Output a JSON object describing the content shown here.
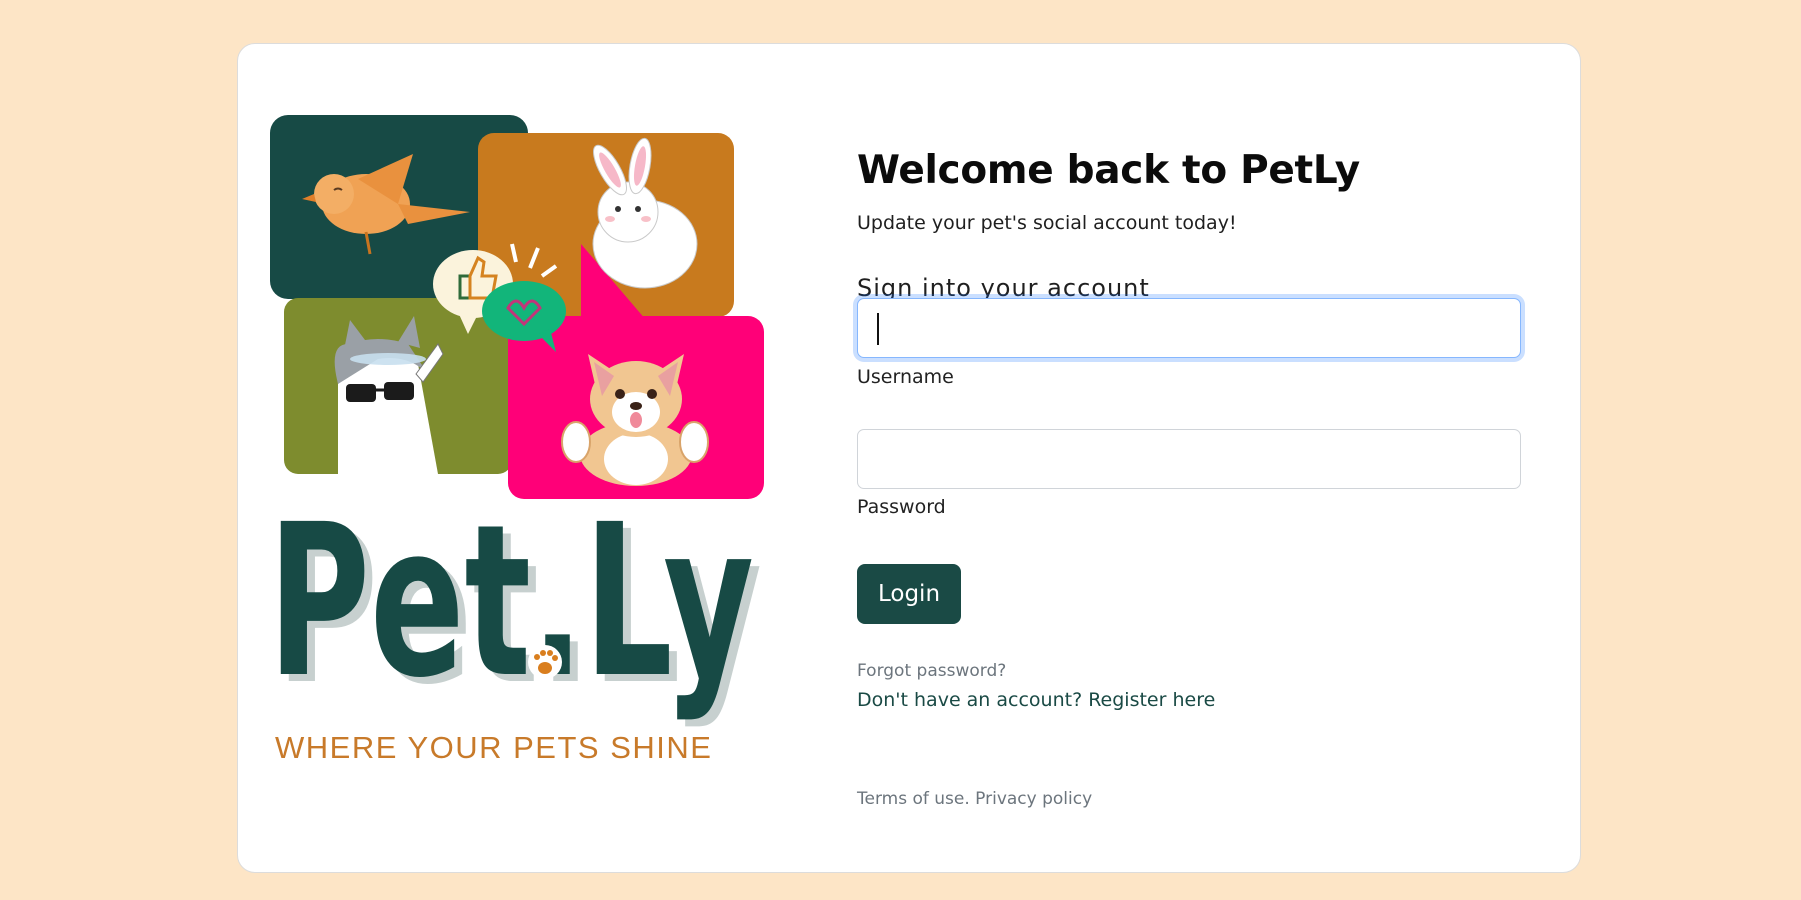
{
  "colors": {
    "page_background": "#fde5c6",
    "brand_dark_green": "#1a4a45",
    "bubble_orange": "#c87a1e",
    "bubble_olive": "#7e8c2e",
    "bubble_pink": "#ff0078",
    "tagline_orange": "#c87a2a",
    "focus_ring": "#86b7fe"
  },
  "logo": {
    "wordmark": "Pet.Ly",
    "tagline": "WHERE YOUR PETS SHINE",
    "illustrations": [
      "bird-icon",
      "rabbit-icon",
      "cat-with-sunglasses-icon",
      "corgi-icon",
      "thumbs-up-icon",
      "heart-bubble-icon",
      "paw-icon"
    ]
  },
  "header": {
    "title": "Welcome back to PetLy",
    "subtitle": "Update your pet's social account today!"
  },
  "form": {
    "heading": "Sign into your account",
    "username": {
      "label": "Username",
      "value": ""
    },
    "password": {
      "label": "Password",
      "value": ""
    },
    "login_label": "Login",
    "forgot_password": "Forgot password?",
    "register_link": "Don't have an account? Register here"
  },
  "footer": {
    "terms": "Terms of use.",
    "privacy": "Privacy policy"
  }
}
